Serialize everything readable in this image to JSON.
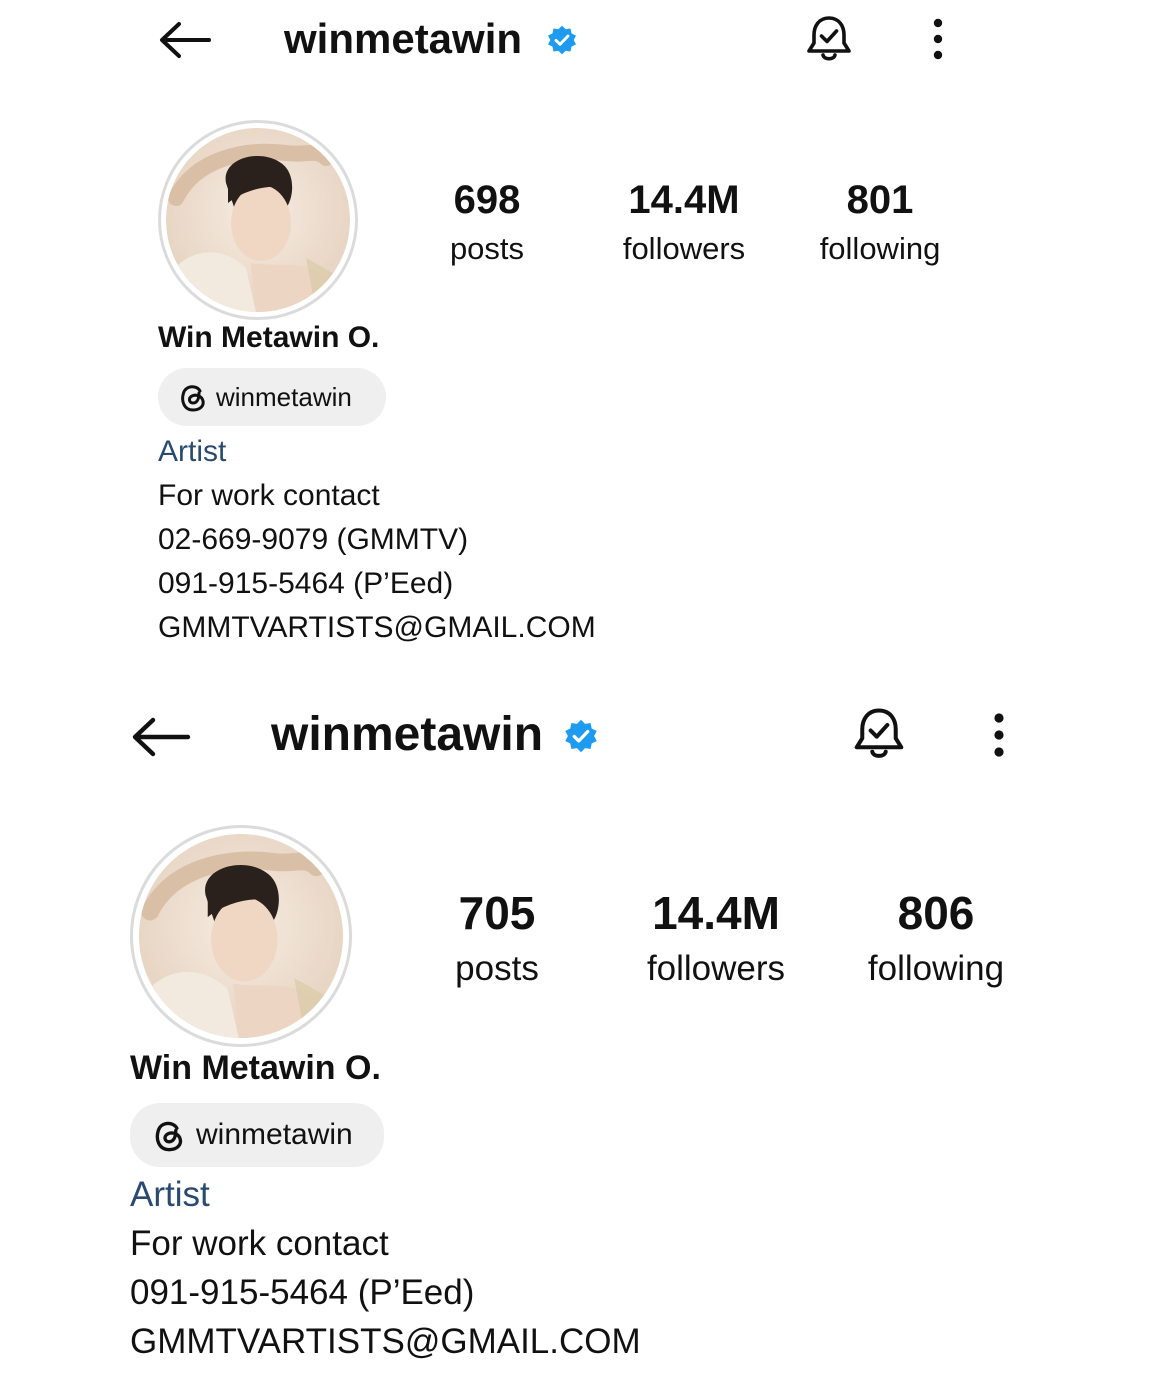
{
  "profiles": [
    {
      "username": "winmetawin",
      "stats": {
        "posts_count": "698",
        "posts_label": "posts",
        "followers_count": "14.4M",
        "followers_label": "followers",
        "following_count": "801",
        "following_label": "following"
      },
      "display_name": "Win Metawin O.",
      "threads_handle": "winmetawin",
      "category": "Artist",
      "bio": [
        "For work contact",
        "02-669-9079 (GMMTV)",
        "091-915-5464 (P’Eed)",
        "GMMTVARTISTS@GMAIL.COM"
      ]
    },
    {
      "username": "winmetawin",
      "stats": {
        "posts_count": "705",
        "posts_label": "posts",
        "followers_count": "14.4M",
        "followers_label": "followers",
        "following_count": "806",
        "following_label": "following"
      },
      "display_name": "Win Metawin O.",
      "threads_handle": "winmetawin",
      "category": "Artist",
      "bio": [
        "For work contact",
        "091-915-5464 (P’Eed)",
        "GMMTVARTISTS@GMAIL.COM"
      ]
    }
  ],
  "icons": {
    "back": "back-arrow-icon",
    "verified": "verified-badge-icon",
    "notifications": "bell-check-icon",
    "more": "more-options-icon",
    "threads": "threads-icon"
  },
  "colors": {
    "verified": "#1d9bf0",
    "category": "#2a4b71",
    "chip_bg": "#efefef"
  }
}
